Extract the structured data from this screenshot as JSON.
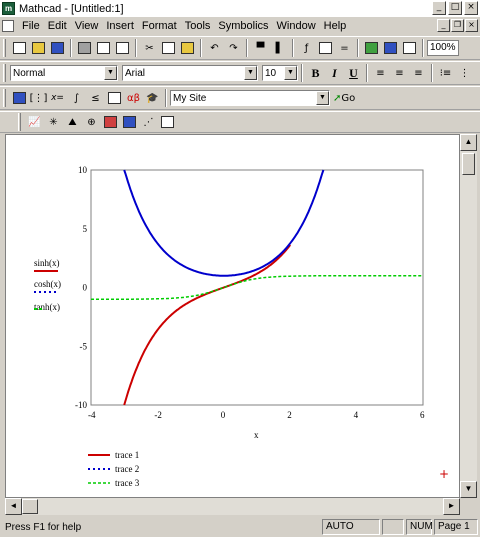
{
  "window": {
    "title": "Mathcad - [Untitled:1]",
    "app_icon_letter": "m"
  },
  "menu": {
    "items": [
      "File",
      "Edit",
      "View",
      "Insert",
      "Format",
      "Tools",
      "Symbolics",
      "Window",
      "Help"
    ]
  },
  "format_bar": {
    "style": "Normal",
    "font": "Arial",
    "size": "10",
    "bold": "B",
    "italic": "I",
    "underline": "U"
  },
  "resources_bar": {
    "site": "My Site",
    "go_label": "Go"
  },
  "zoom": "100%",
  "plot": {
    "legend_left": [
      "sinh(x)",
      "cosh(x)",
      "tanh(x)"
    ],
    "xlabel": "x",
    "trace_legend": [
      "trace 1",
      "trace 2",
      "trace 3"
    ],
    "colors": {
      "trace1": "#cc0000",
      "trace2": "#0000cc",
      "trace3": "#00cc00"
    }
  },
  "chart_data": {
    "type": "line",
    "xlim": [
      -4,
      6
    ],
    "ylim": [
      -10,
      10
    ],
    "x_ticks": [
      "-4",
      "-2",
      "0",
      "2",
      "4",
      "6"
    ],
    "y_ticks": [
      "10",
      "5",
      "0",
      "-5",
      "-10"
    ],
    "xlabel": "x",
    "series": [
      {
        "name": "sinh(x)",
        "x": [
          -3.0,
          -2.5,
          -2.0,
          -1.5,
          -1.0,
          -0.5,
          0.0,
          0.5,
          1.0,
          1.5,
          2.0
        ],
        "y": [
          -10.02,
          -6.05,
          -3.63,
          -2.13,
          -1.18,
          -0.52,
          0.0,
          0.52,
          1.18,
          2.13,
          3.63
        ]
      },
      {
        "name": "cosh(x)",
        "x": [
          -3.0,
          -2.5,
          -2.0,
          -1.5,
          -1.0,
          -0.5,
          0.0,
          0.5,
          1.0,
          1.5,
          2.0,
          2.5,
          3.0
        ],
        "y": [
          10.07,
          6.13,
          3.76,
          2.35,
          1.54,
          1.13,
          1.0,
          1.13,
          1.54,
          2.35,
          3.76,
          6.13,
          10.07
        ]
      },
      {
        "name": "tanh(x)",
        "x": [
          -4.0,
          -3.0,
          -2.0,
          -1.0,
          0.0,
          1.0,
          2.0,
          3.0,
          4.0,
          5.0,
          6.0
        ],
        "y": [
          -1.0,
          -0.995,
          -0.96,
          -0.76,
          0.0,
          0.76,
          0.96,
          0.995,
          1.0,
          1.0,
          1.0
        ]
      }
    ]
  },
  "status": {
    "help": "Press F1 for help",
    "mode": "AUTO",
    "num": "NUM",
    "page": "Page 1"
  }
}
